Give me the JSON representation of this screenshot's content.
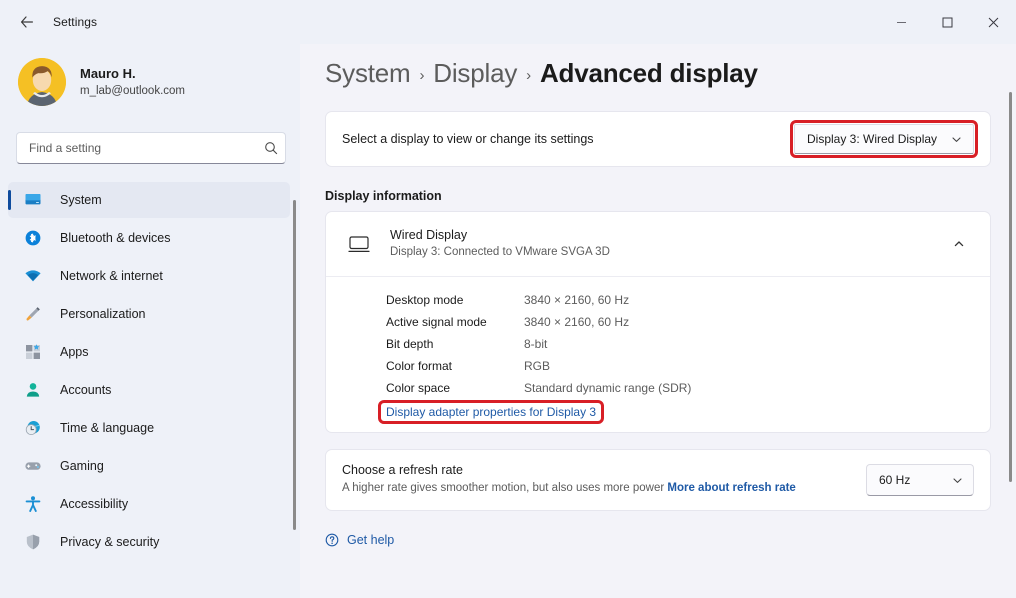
{
  "window": {
    "title": "Settings",
    "back_icon": "back-arrow-icon",
    "minimize_label": "Minimize",
    "maximize_label": "Maximize",
    "close_label": "Close"
  },
  "account": {
    "name": "Mauro H.",
    "email": "m_lab@outlook.com",
    "avatar_color": "#f5c024"
  },
  "search": {
    "placeholder": "Find a setting",
    "value": "",
    "icon": "search-icon"
  },
  "sidebar": {
    "items": [
      {
        "label": "System",
        "icon": "monitor-icon",
        "selected": true
      },
      {
        "label": "Bluetooth & devices",
        "icon": "bluetooth-icon",
        "selected": false
      },
      {
        "label": "Network & internet",
        "icon": "wifi-icon",
        "selected": false
      },
      {
        "label": "Personalization",
        "icon": "paintbrush-icon",
        "selected": false
      },
      {
        "label": "Apps",
        "icon": "apps-icon",
        "selected": false
      },
      {
        "label": "Accounts",
        "icon": "person-icon",
        "selected": false
      },
      {
        "label": "Time & language",
        "icon": "clock-globe-icon",
        "selected": false
      },
      {
        "label": "Gaming",
        "icon": "gamepad-icon",
        "selected": false
      },
      {
        "label": "Accessibility",
        "icon": "accessibility-icon",
        "selected": false
      },
      {
        "label": "Privacy & security",
        "icon": "shield-icon",
        "selected": false
      }
    ],
    "accent_color": "#0f4c9e"
  },
  "breadcrumb": {
    "crumb1": "System",
    "crumb2": "Display",
    "separator": "›",
    "current": "Advanced display"
  },
  "select_display": {
    "label": "Select a display to view or change its settings",
    "dropdown_value": "Display 3: Wired Display",
    "chevron_icon": "chevron-down-icon",
    "highlighted": true,
    "highlight_color": "#d81f26"
  },
  "display_information": {
    "section_title": "Display information",
    "header": {
      "icon": "monitor-icon",
      "title": "Wired Display",
      "subtitle": "Display 3: Connected to VMware SVGA 3D",
      "chevron_icon": "chevron-up-icon"
    },
    "rows": [
      {
        "key": "Desktop mode",
        "value": "3840 × 2160, 60 Hz"
      },
      {
        "key": "Active signal mode",
        "value": "3840 × 2160, 60 Hz"
      },
      {
        "key": "Bit depth",
        "value": "8-bit"
      },
      {
        "key": "Color format",
        "value": "RGB"
      },
      {
        "key": "Color space",
        "value": "Standard dynamic range (SDR)"
      }
    ],
    "adapter_link": "Display adapter properties for Display 3",
    "adapter_link_highlighted": true
  },
  "refresh_rate": {
    "title": "Choose a refresh rate",
    "description": "A higher rate gives smoother motion, but also uses more power",
    "link": "More about refresh rate",
    "dropdown_value": "60 Hz",
    "chevron_icon": "chevron-down-icon"
  },
  "footer": {
    "get_help": "Get help",
    "icon": "help-icon"
  }
}
